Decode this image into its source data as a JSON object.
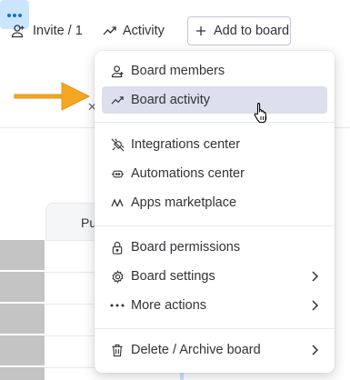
{
  "toolbar": {
    "invite_label": "Invite / 1",
    "activity_label": "Activity",
    "add_board_label": "Add to board",
    "more_icon": "ellipsis-icon"
  },
  "background": {
    "column_header": "Pu"
  },
  "menu": {
    "items": [
      {
        "label": "Board members",
        "icon": "person-add-icon"
      },
      {
        "label": "Board activity",
        "icon": "activity-icon"
      },
      {
        "label": "Integrations center",
        "icon": "plug-icon"
      },
      {
        "label": "Automations center",
        "icon": "robot-icon"
      },
      {
        "label": "Apps marketplace",
        "icon": "apps-icon"
      },
      {
        "label": "Board permissions",
        "icon": "lock-icon"
      },
      {
        "label": "Board settings",
        "icon": "gear-icon"
      },
      {
        "label": "More actions",
        "icon": "more-icon"
      },
      {
        "label": "Delete / Archive board",
        "icon": "trash-icon"
      }
    ]
  },
  "colors": {
    "accent_bg": "#cce5ff",
    "accent": "#0073ea",
    "arrow": "#f5a623",
    "hover": "#dcdfec"
  }
}
